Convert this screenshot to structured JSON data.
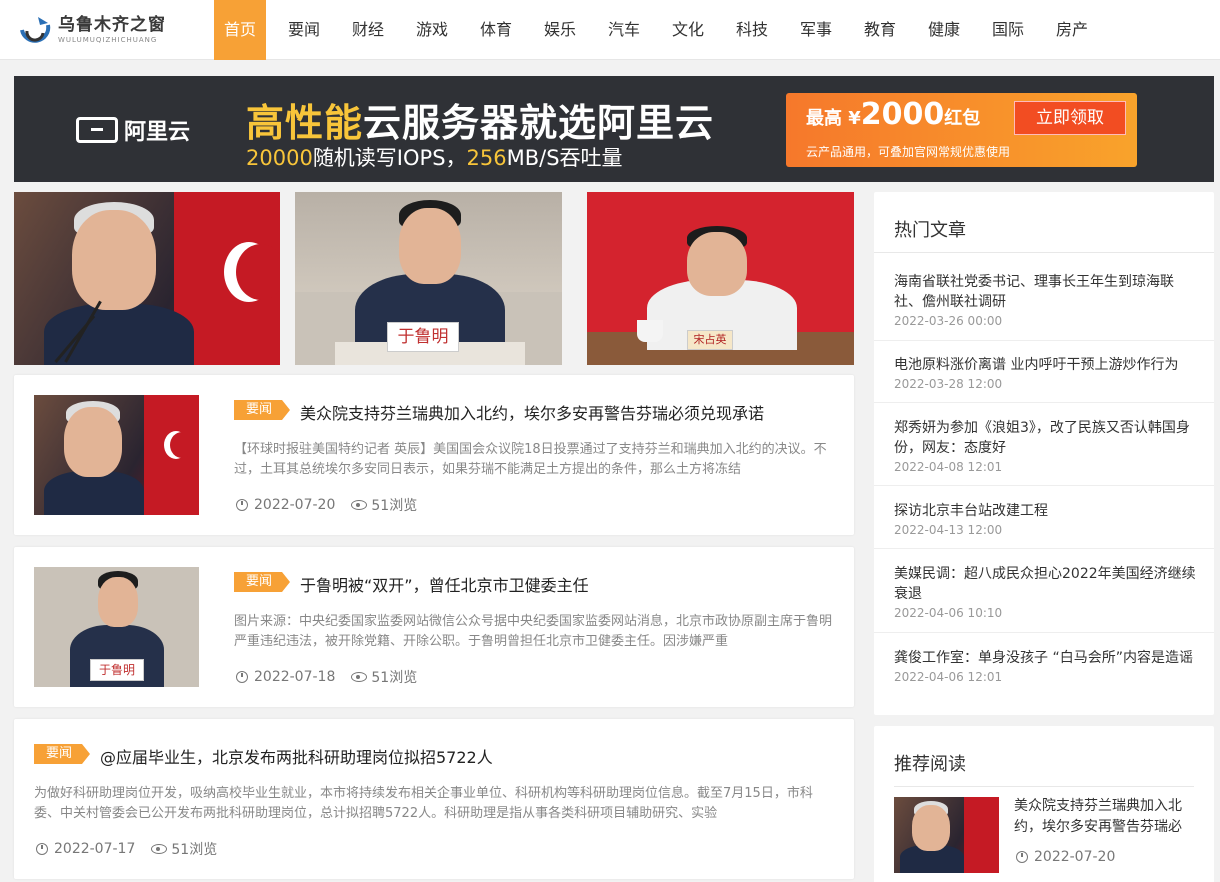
{
  "header": {
    "logo_cn": "乌鲁木齐之窗",
    "logo_en": "WULUMUQIZHICHUANG",
    "nav": [
      "首页",
      "要闻",
      "财经",
      "游戏",
      "体育",
      "娱乐",
      "汽车",
      "文化",
      "科技",
      "军事",
      "教育",
      "健康",
      "国际",
      "房产"
    ],
    "active_nav": "首页"
  },
  "banner": {
    "brand": "阿里云",
    "title_hl": "高性能",
    "title_rest": "云服务器就选阿里云",
    "sub_num1": "20000",
    "sub_text1": "随机读写IOPS，",
    "sub_num2": "256",
    "sub_text2": "MB/S吞吐量",
    "promo_prefix": "最高 ¥",
    "promo_amount": "2000",
    "promo_unit": "红包",
    "promo_btn": "立即领取",
    "promo_note": "云产品通用，可叠加官网常规优惠使用"
  },
  "image_row": {
    "tile2_nameplate": "于鲁明",
    "tile3_nameplate": "宋占英"
  },
  "articles": [
    {
      "tag": "要闻",
      "title": "美众院支持芬兰瑞典加入北约，埃尔多安再警告芬瑞必须兑现承诺",
      "summary": "【环球时报驻美国特约记者 英辰】美国国会众议院18日投票通过了支持芬兰和瑞典加入北约的决议。不过，土耳其总统埃尔多安同日表示，如果芬瑞不能满足土方提出的条件，那么土方将冻结",
      "date": "2022-07-20",
      "views": "51浏览"
    },
    {
      "tag": "要闻",
      "title": "于鲁明被“双开”，曾任北京市卫健委主任",
      "summary": "图片来源：中央纪委国家监委网站微信公众号据中央纪委国家监委网站消息，北京市政协原副主席于鲁明严重违纪违法，被开除党籍、开除公职。于鲁明曾担任北京市卫健委主任。因涉嫌严重",
      "date": "2022-07-18",
      "views": "51浏览",
      "nameplate": "于鲁明"
    },
    {
      "tag": "要闻",
      "title": "@应届毕业生，北京发布两批科研助理岗位拟招5722人",
      "summary": "为做好科研助理岗位开发，吸纳高校毕业生就业，本市将持续发布相关企事业单位、科研机构等科研助理岗位信息。截至7月15日，市科委、中关村管委会已公开发布两批科研助理岗位，总计拟招聘5722人。科研助理是指从事各类科研项目辅助研究、实验",
      "date": "2022-07-17",
      "views": "51浏览"
    }
  ],
  "hot": {
    "heading": "热门文章",
    "items": [
      {
        "title": "海南省联社党委书记、理事长王年生到琼海联社、儋州联社调研",
        "date": "2022-03-26 00:00"
      },
      {
        "title": "电池原料涨价离谱 业内呼吁干预上游炒作行为",
        "date": "2022-03-28 12:00"
      },
      {
        "title": "郑秀妍为参加《浪姐3》，改了民族又否认韩国身份，网友：态度好",
        "date": "2022-04-08 12:01"
      },
      {
        "title": "探访北京丰台站改建工程",
        "date": "2022-04-13 12:00"
      },
      {
        "title": "美媒民调：超八成民众担心2022年美国经济继续衰退",
        "date": "2022-04-06 10:10"
      },
      {
        "title": "龚俊工作室：单身没孩子 “白马会所”内容是造谣",
        "date": "2022-04-06 12:01"
      }
    ]
  },
  "recommend": {
    "heading": "推荐阅读",
    "title": "美众院支持芬兰瑞典加入北约，埃尔多安再警告芬瑞必",
    "date": "2022-07-20"
  }
}
